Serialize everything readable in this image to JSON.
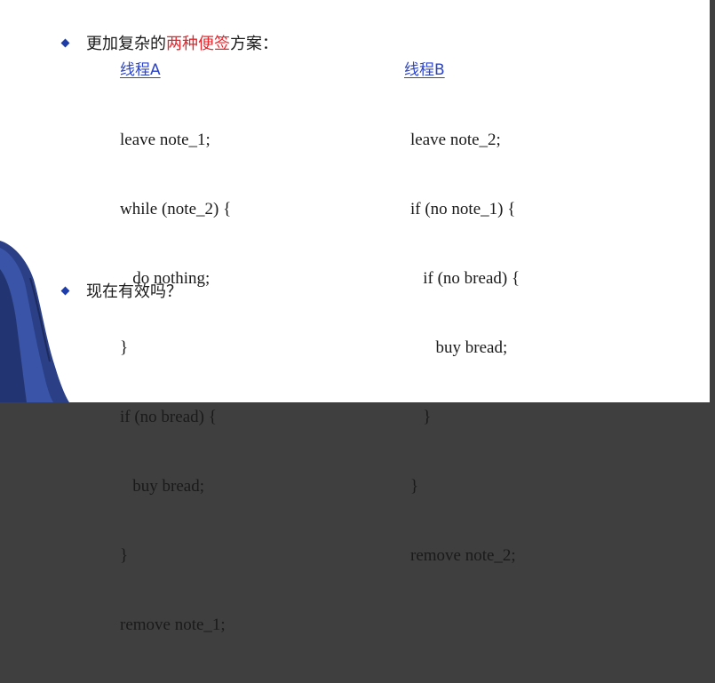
{
  "bullets": {
    "first": {
      "prefix": "更加复杂的",
      "highlight": "两种便签",
      "suffix": "方案："
    },
    "second": "现在有效吗？"
  },
  "thread_a": {
    "title": "线程A",
    "lines": [
      "leave note_1;",
      "while (note_2) {",
      "   do nothing;",
      "}",
      "if (no bread) {",
      "   buy bread;",
      "}",
      "remove note_1;"
    ]
  },
  "thread_b": {
    "title": "线程B",
    "lines": [
      "leave note_2;",
      "if (no note_1) {",
      "   if (no bread) {",
      "      buy bread;",
      "   }",
      "}",
      "remove note_2;"
    ]
  },
  "colors": {
    "highlight": "#e8232a",
    "title_blue": "#2c44c8",
    "bullet_blue": "#1e3da8"
  }
}
